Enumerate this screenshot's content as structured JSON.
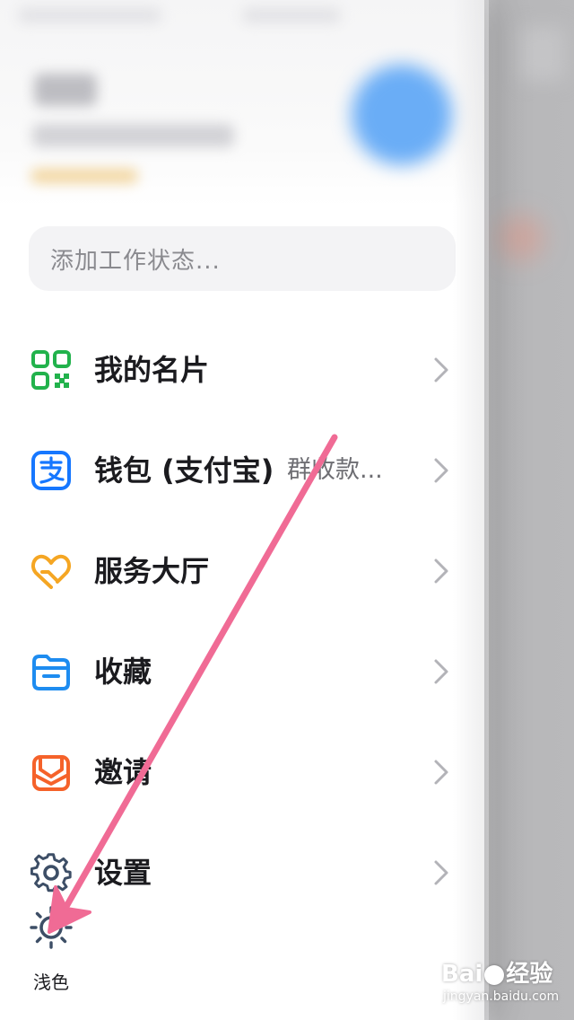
{
  "status_input": {
    "placeholder": "添加工作状态..."
  },
  "menu": [
    {
      "id": "my-card",
      "label": "我的名片",
      "icon": "qr-code-icon",
      "icon_color": "#22b24c"
    },
    {
      "id": "wallet",
      "label": "钱包 (支付宝)",
      "hint": "群收款...",
      "icon": "alipay-icon",
      "icon_color": "#1677ff"
    },
    {
      "id": "service-hall",
      "label": "服务大厅",
      "icon": "heart-hand-icon",
      "icon_color": "#f5a623"
    },
    {
      "id": "favorites",
      "label": "收藏",
      "icon": "folder-icon",
      "icon_color": "#1e8cf0"
    },
    {
      "id": "invite",
      "label": "邀请",
      "icon": "envelope-icon",
      "icon_color": "#f5622a"
    },
    {
      "id": "settings",
      "label": "设置",
      "icon": "gear-icon",
      "icon_color": "#3d4e66"
    }
  ],
  "theme_toggle": {
    "label": "浅色",
    "icon": "sun-icon"
  },
  "annotation": {
    "color": "#f06b95"
  },
  "watermark": {
    "logo": "Bai",
    "logo_suffix": "经验",
    "url": "jingyan.baidu.com"
  }
}
